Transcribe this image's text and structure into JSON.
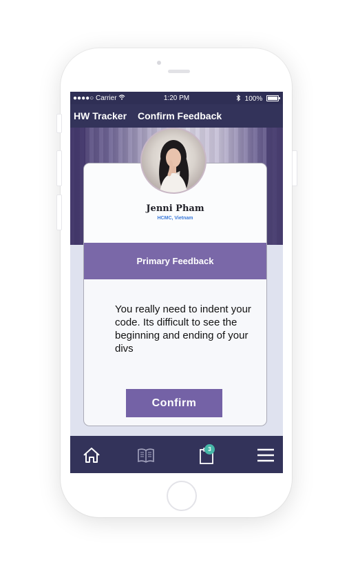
{
  "status_bar": {
    "signal_dots": "●●●●○",
    "carrier": "Carrier",
    "time": "1:20 PM",
    "bluetooth_icon": "bluetooth-icon",
    "battery": "100%"
  },
  "nav": {
    "app_title": "HW Tracker",
    "page_title": "Confirm Feedback"
  },
  "profile": {
    "name": "Jenni Pham",
    "location": "HCMC, Vietnam"
  },
  "feedback": {
    "section_title": "Primary Feedback",
    "message": "You really need to indent your code. Its difficult to see the beginning and ending of your divs"
  },
  "confirm_label": "Confirm",
  "tab_bar": {
    "items": [
      {
        "icon": "home-icon"
      },
      {
        "icon": "book-icon"
      },
      {
        "icon": "clipboard-icon",
        "badge": "3"
      },
      {
        "icon": "menu-icon"
      }
    ],
    "badge_color": "#47b7a8"
  },
  "colors": {
    "nav_bg": "#33335a",
    "accent": "#7a68a8",
    "button": "#7462a6",
    "location_text": "#3b7ad9"
  }
}
